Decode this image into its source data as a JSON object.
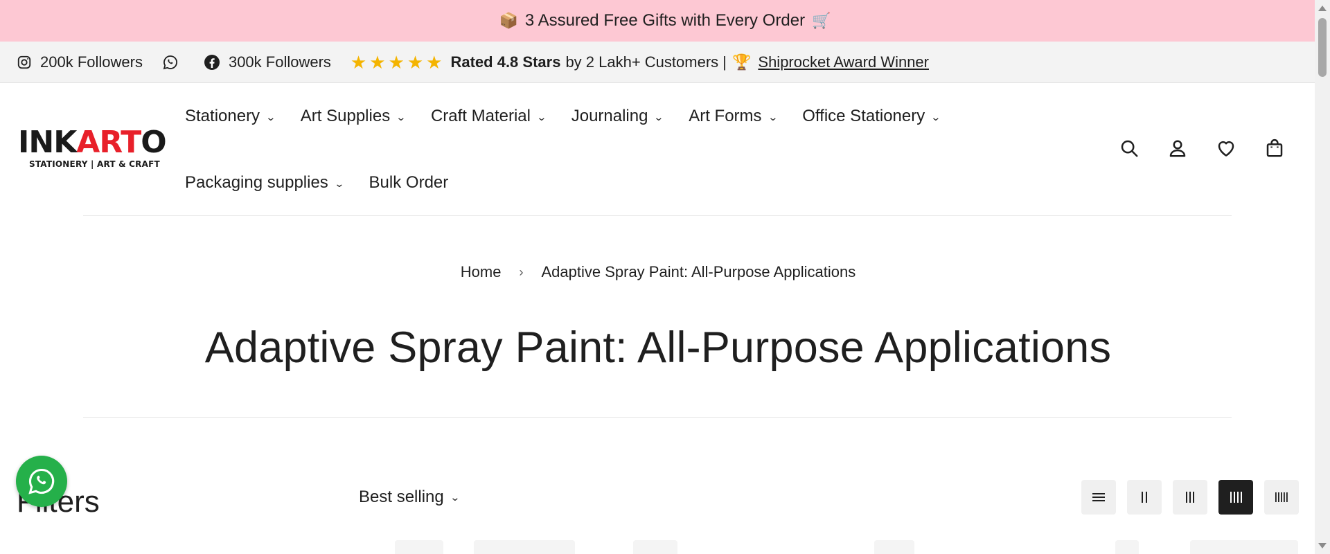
{
  "announcement": {
    "emoji_left": "📦",
    "text": "3 Assured Free Gifts with Every Order",
    "emoji_right": "🛒"
  },
  "social_bar": {
    "instagram_followers": "200k Followers",
    "facebook_followers": "300k Followers",
    "rating_bold": "Rated 4.8 Stars",
    "rating_rest": "by 2 Lakh+ Customers |",
    "award_emoji": "🏆",
    "award_link": "Shiprocket Award Winner",
    "stars": 5
  },
  "logo": {
    "part1": "INK",
    "part2": "ART",
    "part3": "O",
    "tagline": "STATIONERY | ART & CRAFT"
  },
  "nav": {
    "row1": [
      "Stationery",
      "Art Supplies",
      "Craft Material",
      "Journaling",
      "Art Forms",
      "Office Stationery"
    ],
    "row2": [
      "Packaging supplies",
      "Bulk Order"
    ]
  },
  "header_icons": [
    "search-icon",
    "account-icon",
    "wishlist-icon",
    "cart-icon"
  ],
  "breadcrumb": {
    "home": "Home",
    "separator": "›",
    "current": "Adaptive Spray Paint: All-Purpose Applications"
  },
  "page_title": "Adaptive Spray Paint: All-Purpose Applications",
  "filters_heading": "Filters",
  "sort": {
    "selected": "Best selling"
  },
  "view_modes": {
    "options": [
      "list",
      "2-column",
      "3-column",
      "4-column",
      "5-column"
    ],
    "active": "4-column"
  },
  "colors": {
    "announce_bg": "#fdc8d3",
    "logo_red": "#e8202a",
    "whatsapp": "#25b04a",
    "star": "#f4b400"
  }
}
